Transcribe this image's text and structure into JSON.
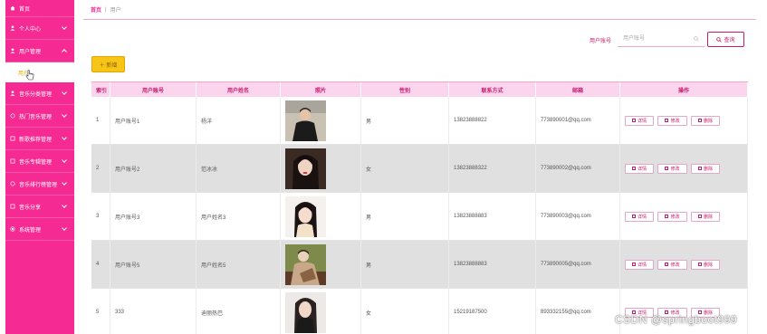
{
  "sidebar": {
    "items": [
      {
        "label": "首页",
        "icon": "home-icon"
      },
      {
        "label": "个人中心",
        "icon": "user-icon"
      },
      {
        "label": "用户管理",
        "icon": "users-icon",
        "expanded": true
      },
      {
        "label": "音乐分类管理",
        "icon": "category-icon"
      },
      {
        "label": "热门音乐管理",
        "icon": "fire-icon"
      },
      {
        "label": "新歌推荐管理",
        "icon": "note-icon"
      },
      {
        "label": "音乐专辑管理",
        "icon": "album-icon"
      },
      {
        "label": "音乐排行榜管理",
        "icon": "rank-icon"
      },
      {
        "label": "音乐分享",
        "icon": "share-icon"
      },
      {
        "label": "系统管理",
        "icon": "settings-icon"
      }
    ],
    "sub_item": {
      "label": "用户"
    }
  },
  "breadcrumb": {
    "home": "首页",
    "separator": "|",
    "current": "用户"
  },
  "search": {
    "label": "用户账号",
    "placeholder": "用户账号",
    "button": "查询"
  },
  "add_button": "＋ 新增",
  "table": {
    "headers": [
      "索引",
      "用户账号",
      "用户姓名",
      "照片",
      "性别",
      "联系方式",
      "邮箱",
      "操作"
    ],
    "rows": [
      {
        "index": "1",
        "account": "用户账号1",
        "name": "杨洋",
        "gender": "男",
        "phone": "13823888822",
        "email": "773890001@qq.com"
      },
      {
        "index": "2",
        "account": "用户账号2",
        "name": "范冰冰",
        "gender": "女",
        "phone": "13823888322",
        "email": "773890002@qq.com"
      },
      {
        "index": "3",
        "account": "用户账号3",
        "name": "用户姓名3",
        "gender": "男",
        "phone": "13823888883",
        "email": "773890003@qq.com"
      },
      {
        "index": "4",
        "account": "用户账号5",
        "name": "用户姓名5",
        "gender": "男",
        "phone": "13823888883",
        "email": "773890005@qq.com"
      },
      {
        "index": "5",
        "account": "333",
        "name": "迪丽热巴",
        "gender": "女",
        "phone": "15219187500",
        "email": "893332155@qq.com"
      }
    ],
    "actions": {
      "detail": "详情",
      "edit": "修改",
      "delete": "删除"
    }
  },
  "watermark": "CSDN @springboot999",
  "colors": {
    "sidebar": "#f52b93",
    "header_bg": "#fbd4ee",
    "accent": "#c71a6c",
    "add_button": "#f5c518",
    "alt_row": "#e0e0e0"
  }
}
